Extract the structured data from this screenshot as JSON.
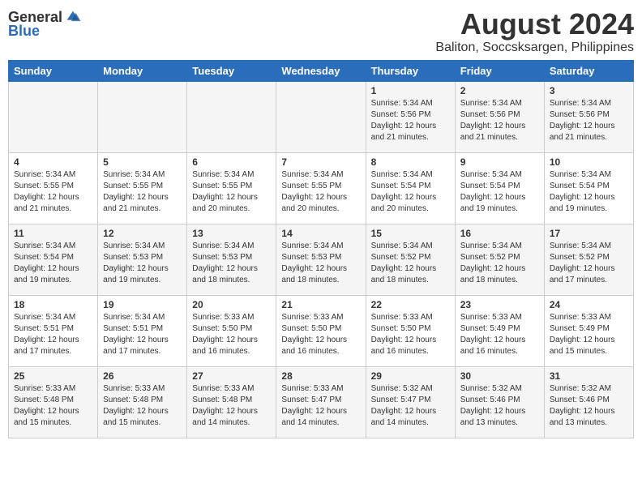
{
  "logo": {
    "general": "General",
    "blue": "Blue"
  },
  "title": "August 2024",
  "location": "Baliton, Soccsksargen, Philippines",
  "days_header": [
    "Sunday",
    "Monday",
    "Tuesday",
    "Wednesday",
    "Thursday",
    "Friday",
    "Saturday"
  ],
  "weeks": [
    [
      {
        "day": "",
        "info": ""
      },
      {
        "day": "",
        "info": ""
      },
      {
        "day": "",
        "info": ""
      },
      {
        "day": "",
        "info": ""
      },
      {
        "day": "1",
        "info": "Sunrise: 5:34 AM\nSunset: 5:56 PM\nDaylight: 12 hours\nand 21 minutes."
      },
      {
        "day": "2",
        "info": "Sunrise: 5:34 AM\nSunset: 5:56 PM\nDaylight: 12 hours\nand 21 minutes."
      },
      {
        "day": "3",
        "info": "Sunrise: 5:34 AM\nSunset: 5:56 PM\nDaylight: 12 hours\nand 21 minutes."
      }
    ],
    [
      {
        "day": "4",
        "info": "Sunrise: 5:34 AM\nSunset: 5:55 PM\nDaylight: 12 hours\nand 21 minutes."
      },
      {
        "day": "5",
        "info": "Sunrise: 5:34 AM\nSunset: 5:55 PM\nDaylight: 12 hours\nand 21 minutes."
      },
      {
        "day": "6",
        "info": "Sunrise: 5:34 AM\nSunset: 5:55 PM\nDaylight: 12 hours\nand 20 minutes."
      },
      {
        "day": "7",
        "info": "Sunrise: 5:34 AM\nSunset: 5:55 PM\nDaylight: 12 hours\nand 20 minutes."
      },
      {
        "day": "8",
        "info": "Sunrise: 5:34 AM\nSunset: 5:54 PM\nDaylight: 12 hours\nand 20 minutes."
      },
      {
        "day": "9",
        "info": "Sunrise: 5:34 AM\nSunset: 5:54 PM\nDaylight: 12 hours\nand 19 minutes."
      },
      {
        "day": "10",
        "info": "Sunrise: 5:34 AM\nSunset: 5:54 PM\nDaylight: 12 hours\nand 19 minutes."
      }
    ],
    [
      {
        "day": "11",
        "info": "Sunrise: 5:34 AM\nSunset: 5:54 PM\nDaylight: 12 hours\nand 19 minutes."
      },
      {
        "day": "12",
        "info": "Sunrise: 5:34 AM\nSunset: 5:53 PM\nDaylight: 12 hours\nand 19 minutes."
      },
      {
        "day": "13",
        "info": "Sunrise: 5:34 AM\nSunset: 5:53 PM\nDaylight: 12 hours\nand 18 minutes."
      },
      {
        "day": "14",
        "info": "Sunrise: 5:34 AM\nSunset: 5:53 PM\nDaylight: 12 hours\nand 18 minutes."
      },
      {
        "day": "15",
        "info": "Sunrise: 5:34 AM\nSunset: 5:52 PM\nDaylight: 12 hours\nand 18 minutes."
      },
      {
        "day": "16",
        "info": "Sunrise: 5:34 AM\nSunset: 5:52 PM\nDaylight: 12 hours\nand 18 minutes."
      },
      {
        "day": "17",
        "info": "Sunrise: 5:34 AM\nSunset: 5:52 PM\nDaylight: 12 hours\nand 17 minutes."
      }
    ],
    [
      {
        "day": "18",
        "info": "Sunrise: 5:34 AM\nSunset: 5:51 PM\nDaylight: 12 hours\nand 17 minutes."
      },
      {
        "day": "19",
        "info": "Sunrise: 5:34 AM\nSunset: 5:51 PM\nDaylight: 12 hours\nand 17 minutes."
      },
      {
        "day": "20",
        "info": "Sunrise: 5:33 AM\nSunset: 5:50 PM\nDaylight: 12 hours\nand 16 minutes."
      },
      {
        "day": "21",
        "info": "Sunrise: 5:33 AM\nSunset: 5:50 PM\nDaylight: 12 hours\nand 16 minutes."
      },
      {
        "day": "22",
        "info": "Sunrise: 5:33 AM\nSunset: 5:50 PM\nDaylight: 12 hours\nand 16 minutes."
      },
      {
        "day": "23",
        "info": "Sunrise: 5:33 AM\nSunset: 5:49 PM\nDaylight: 12 hours\nand 16 minutes."
      },
      {
        "day": "24",
        "info": "Sunrise: 5:33 AM\nSunset: 5:49 PM\nDaylight: 12 hours\nand 15 minutes."
      }
    ],
    [
      {
        "day": "25",
        "info": "Sunrise: 5:33 AM\nSunset: 5:48 PM\nDaylight: 12 hours\nand 15 minutes."
      },
      {
        "day": "26",
        "info": "Sunrise: 5:33 AM\nSunset: 5:48 PM\nDaylight: 12 hours\nand 15 minutes."
      },
      {
        "day": "27",
        "info": "Sunrise: 5:33 AM\nSunset: 5:48 PM\nDaylight: 12 hours\nand 14 minutes."
      },
      {
        "day": "28",
        "info": "Sunrise: 5:33 AM\nSunset: 5:47 PM\nDaylight: 12 hours\nand 14 minutes."
      },
      {
        "day": "29",
        "info": "Sunrise: 5:32 AM\nSunset: 5:47 PM\nDaylight: 12 hours\nand 14 minutes."
      },
      {
        "day": "30",
        "info": "Sunrise: 5:32 AM\nSunset: 5:46 PM\nDaylight: 12 hours\nand 13 minutes."
      },
      {
        "day": "31",
        "info": "Sunrise: 5:32 AM\nSunset: 5:46 PM\nDaylight: 12 hours\nand 13 minutes."
      }
    ]
  ]
}
